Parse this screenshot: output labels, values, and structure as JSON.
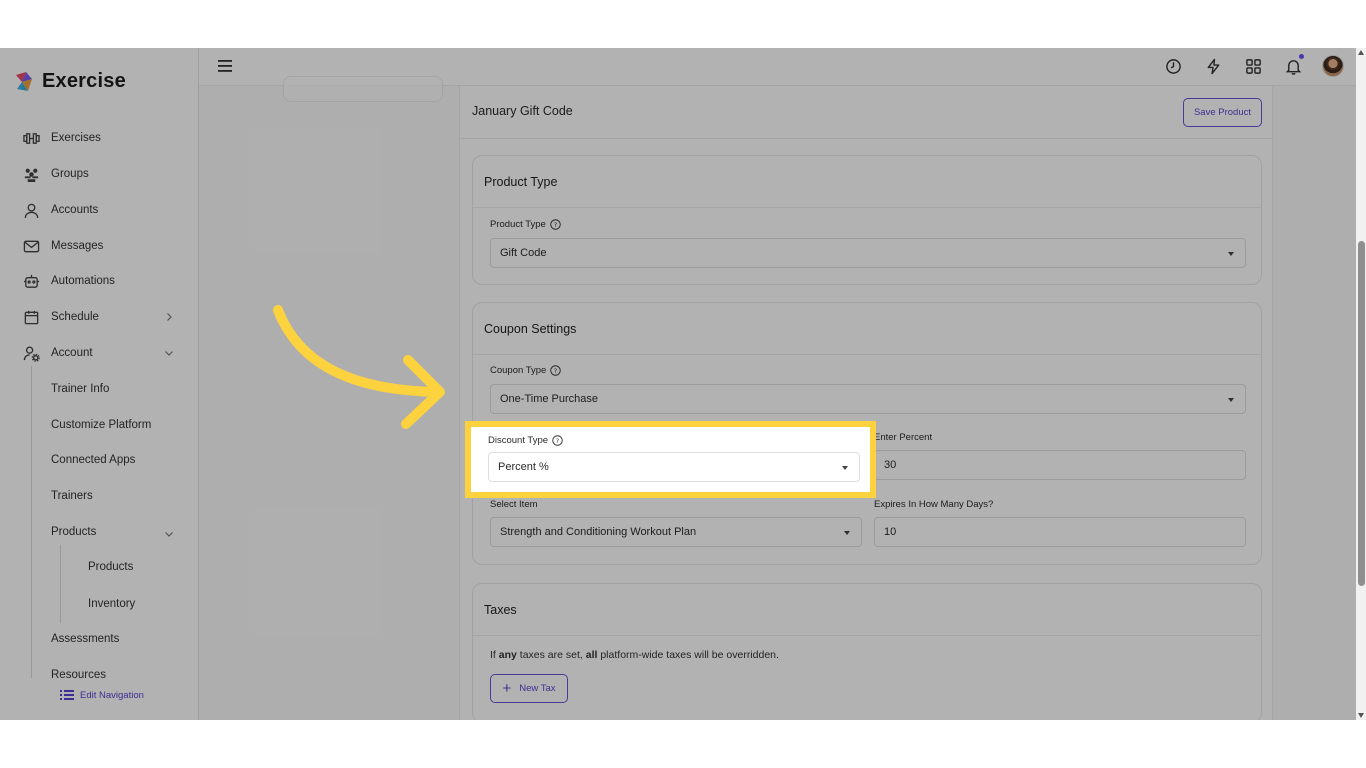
{
  "app": {
    "name": "Exercise"
  },
  "sidebar": {
    "items": [
      {
        "label": "Exercises",
        "icon": "dumbbell-icon"
      },
      {
        "label": "Groups",
        "icon": "groups-icon"
      },
      {
        "label": "Accounts",
        "icon": "user-icon"
      },
      {
        "label": "Messages",
        "icon": "mail-icon"
      },
      {
        "label": "Automations",
        "icon": "robot-icon"
      },
      {
        "label": "Schedule",
        "icon": "calendar-icon"
      },
      {
        "label": "Account",
        "icon": "user-gear-icon"
      }
    ],
    "account_sub": [
      "Trainer Info",
      "Customize Platform",
      "Connected Apps",
      "Trainers",
      "Products"
    ],
    "products_sub": [
      "Products",
      "Inventory"
    ],
    "more_sub": [
      "Assessments",
      "Resources"
    ],
    "edit_navigation": "Edit Navigation"
  },
  "header": {
    "title": "January Gift Code",
    "save_label": "Save Product"
  },
  "product_type_card": {
    "title": "Product Type",
    "field_label": "Product Type",
    "value": "Gift Code"
  },
  "coupon_card": {
    "title": "Coupon Settings",
    "coupon_type_label": "Coupon Type",
    "coupon_type_value": "One-Time Purchase",
    "discount_type_label": "Discount Type",
    "discount_type_value": "Percent %",
    "enter_percent_label": "Enter Percent",
    "enter_percent_value": "30",
    "select_item_label": "Select Item",
    "select_item_value": "Strength and Conditioning Workout Plan",
    "expires_label": "Expires In How Many Days?",
    "expires_value": "10"
  },
  "taxes_card": {
    "title": "Taxes",
    "note_prefix": "If",
    "note_any": "any",
    "note_mid": "taxes are set,",
    "note_all": "all",
    "note_suffix": "platform-wide taxes will be overridden.",
    "new_tax_label": "New Tax"
  },
  "colors": {
    "accent": "#5a45cf",
    "highlight": "#fdd23f",
    "notification": "#6b4ff0"
  }
}
